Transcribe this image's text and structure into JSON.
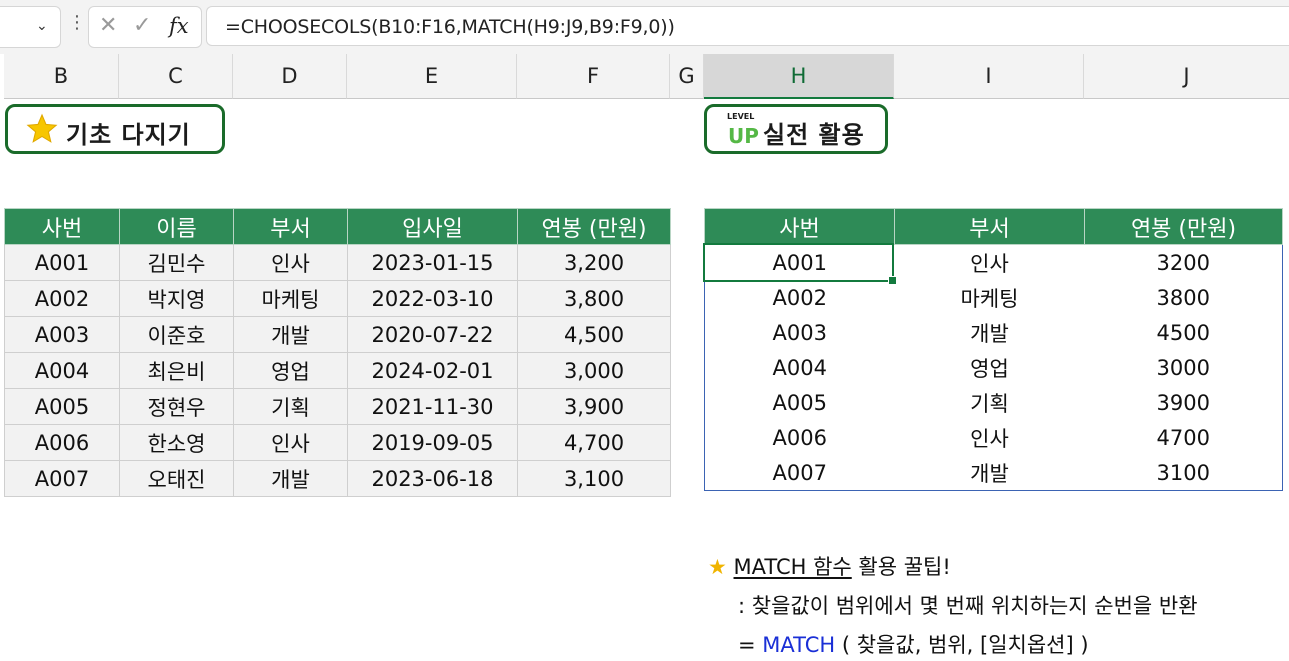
{
  "formula_bar": {
    "formula": "=CHOOSECOLS(B10:F16,MATCH(H9:J9,B9:F9,0))",
    "cancel_glyph": "✕",
    "enter_glyph": "✓",
    "fx_label": "fx",
    "dots": "⋮",
    "chevron": "⌄"
  },
  "columns": [
    "B",
    "C",
    "D",
    "E",
    "F",
    "G",
    "H",
    "I",
    "J"
  ],
  "selected_column": "H",
  "badges": {
    "basic": {
      "label": "기초 다지기",
      "icon": "star-icon"
    },
    "advanced": {
      "label": "실전 활용",
      "icon": "level-up-icon",
      "icon_top": "LEVEL",
      "icon_main": "UP"
    }
  },
  "left_table": {
    "headers": [
      "사번",
      "이름",
      "부서",
      "입사일",
      "연봉 (만원)"
    ],
    "rows": [
      [
        "A001",
        "김민수",
        "인사",
        "2023-01-15",
        "3,200"
      ],
      [
        "A002",
        "박지영",
        "마케팅",
        "2022-03-10",
        "3,800"
      ],
      [
        "A003",
        "이준호",
        "개발",
        "2020-07-22",
        "4,500"
      ],
      [
        "A004",
        "최은비",
        "영업",
        "2024-02-01",
        "3,000"
      ],
      [
        "A005",
        "정현우",
        "기획",
        "2021-11-30",
        "3,900"
      ],
      [
        "A006",
        "한소영",
        "인사",
        "2019-09-05",
        "4,700"
      ],
      [
        "A007",
        "오태진",
        "개발",
        "2023-06-18",
        "3,100"
      ]
    ]
  },
  "right_table": {
    "headers": [
      "사번",
      "부서",
      "연봉 (만원)"
    ],
    "rows": [
      [
        "A001",
        "인사",
        "3200"
      ],
      [
        "A002",
        "마케팅",
        "3800"
      ],
      [
        "A003",
        "개발",
        "4500"
      ],
      [
        "A004",
        "영업",
        "3000"
      ],
      [
        "A005",
        "기획",
        "3900"
      ],
      [
        "A006",
        "인사",
        "4700"
      ],
      [
        "A007",
        "개발",
        "3100"
      ]
    ]
  },
  "notes": {
    "star": "★",
    "title_underlined": "MATCH 함수",
    "title_rest": " 활용 꿀팁!",
    "line2": ": 찾을값이 범위에서 몇 번째 위치하는지 순번을 반환",
    "line3_prefix": "= ",
    "line3_func": "MATCH",
    "line3_args": " ( 찾을값, 범위, [일치옵션] )"
  },
  "colors": {
    "header_green": "#2e8b57",
    "badge_border": "#1a6b2a",
    "selection": "#137a3e",
    "func_blue": "#1a2fd6"
  }
}
